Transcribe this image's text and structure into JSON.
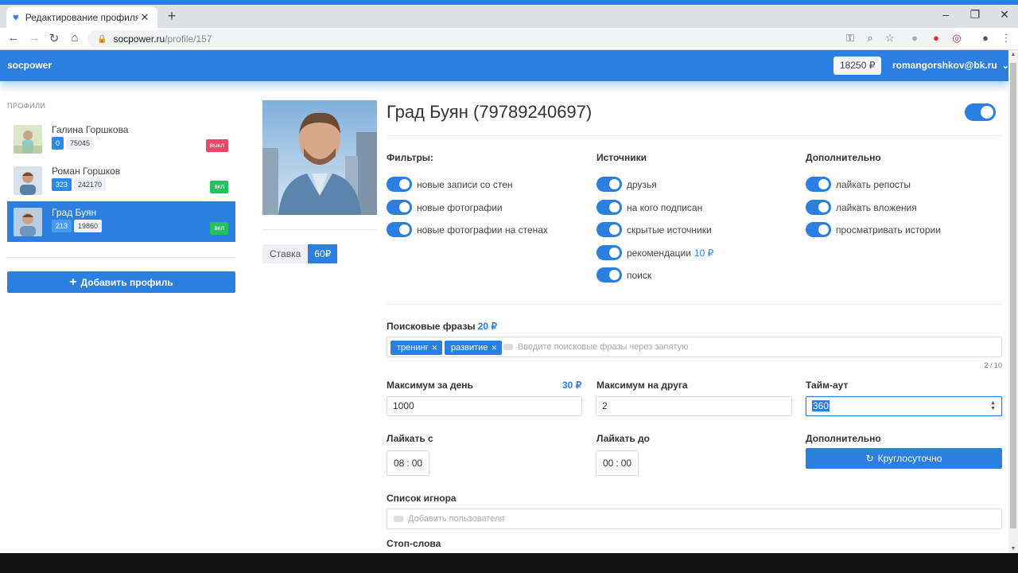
{
  "browser": {
    "tab_title": "Редактирование профиля",
    "url_host": "socpower.ru",
    "url_path": "/profile/157"
  },
  "header": {
    "brand": "socpower",
    "balance": "18250 ₽",
    "user_email": "romangorshkov@bk.ru"
  },
  "sidebar": {
    "title": "ПРОФИЛИ",
    "profiles": [
      {
        "name": "Галина Горшкова",
        "count1": "0",
        "count2": "75045",
        "status": "выкл"
      },
      {
        "name": "Роман Горшков",
        "count1": "323",
        "count2": "242170",
        "status": "вкл"
      },
      {
        "name": "Град Буян",
        "count1": "213",
        "count2": "19860",
        "status": "вкл"
      }
    ],
    "add_button": "Добавить профиль"
  },
  "rate": {
    "label": "Ставка",
    "value": "60₽"
  },
  "profile": {
    "title": "Град Буян (79789240697)",
    "enabled": true,
    "filters_title": "Фильтры:",
    "filters": [
      "новые записи со стен",
      "новые фотографии",
      "новые фотографии на стенах"
    ],
    "sources_title": "Источники",
    "sources": [
      {
        "label": "друзья",
        "price": ""
      },
      {
        "label": "на кого подписан",
        "price": ""
      },
      {
        "label": "скрытые источники",
        "price": ""
      },
      {
        "label": "рекомендации",
        "price": "10 ₽"
      },
      {
        "label": "поиск",
        "price": ""
      }
    ],
    "extra_title": "Дополнительно",
    "extra": [
      "лайкать репосты",
      "лайкать вложения",
      "просматривать истории"
    ]
  },
  "search_phrases": {
    "label": "Поисковые фразы",
    "price": "20 ₽",
    "tags": [
      "тренинг",
      "развитие"
    ],
    "placeholder": "Введите поисковые фразы через запятую",
    "count": "2 / 10"
  },
  "limits": {
    "max_day_label": "Максимум за день",
    "max_day_price": "30 ₽",
    "max_day_value": "1000",
    "max_friend_label": "Максимум на друга",
    "max_friend_value": "2",
    "timeout_label": "Тайм-аут",
    "timeout_value": "360"
  },
  "schedule": {
    "like_from_label": "Лайкать с",
    "like_from_h": "08",
    "like_from_m": "00",
    "like_to_label": "Лайкать до",
    "like_to_h": "00",
    "like_to_m": "00",
    "extra_label": "Дополнительно",
    "round_button": "Круглосуточно"
  },
  "ignore": {
    "label": "Список игнора",
    "placeholder": "Добавить пользователя"
  },
  "stop_words": {
    "label": "Стоп-слова"
  },
  "colors": {
    "accent": "#2b7fe0",
    "off": "#f04567",
    "on": "#22c35e"
  }
}
